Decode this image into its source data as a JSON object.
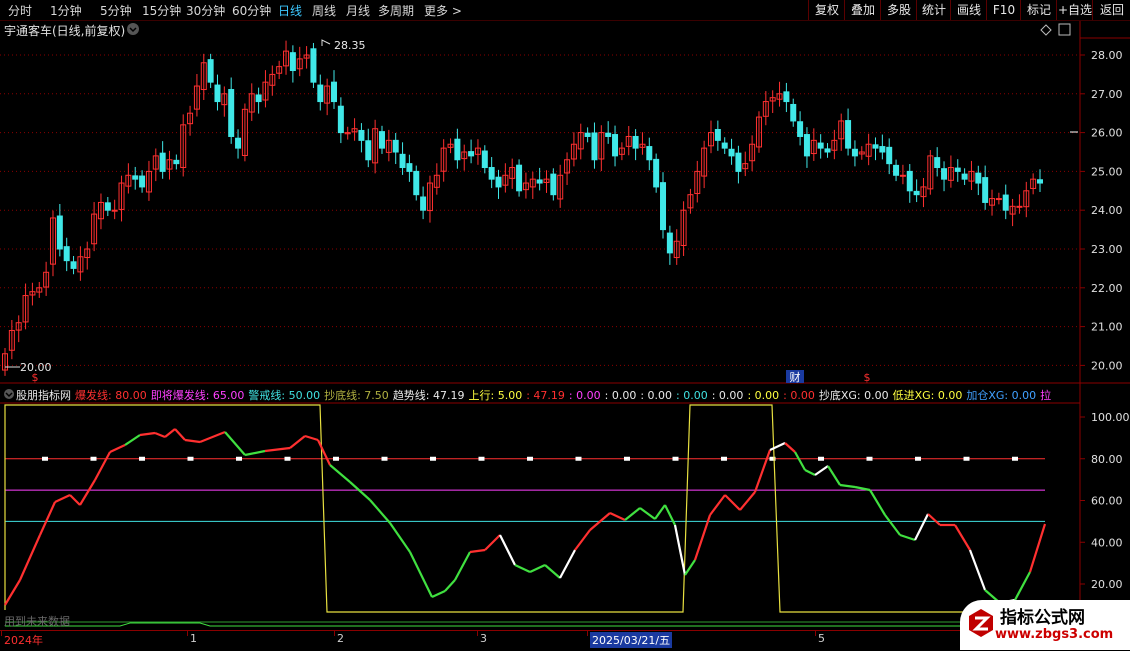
{
  "toolbar": {
    "periods": [
      "分时",
      "1分钟",
      "5分钟",
      "15分钟",
      "30分钟",
      "60分钟",
      "日线",
      "周线",
      "月线",
      "多周期",
      "更多 >"
    ],
    "active_period": "日线",
    "right_buttons": [
      "复权",
      "叠加",
      "多股",
      "统计",
      "画线",
      "F10",
      "标记",
      "+自选",
      "返回"
    ]
  },
  "main_chart": {
    "title": "宇通客车(日线,前复权)",
    "price_ticks": [
      "28.00",
      "27.00",
      "26.00",
      "25.00",
      "24.00",
      "23.00",
      "22.00",
      "21.00",
      "20.00"
    ],
    "high_label": "28.35",
    "low_label": "20.00",
    "event_markers": [
      "$",
      "财",
      "$"
    ]
  },
  "indicator": {
    "name": "股朋指标网",
    "items": [
      {
        "label": "爆发线: 80.00",
        "color": "#ff3030"
      },
      {
        "label": "即将爆发线: 65.00",
        "color": "#ff40ff"
      },
      {
        "label": "警戒线: 50.00",
        "color": "#40e0e0"
      },
      {
        "label": "抄底线: 7.50",
        "color": "#b0b040"
      },
      {
        "label": "趋势线: 47.19",
        "color": "#e8e8e8"
      },
      {
        "label": "上行: 5.00",
        "color": "#ffff40"
      },
      {
        "label": ": 47.19",
        "color": "#ff3030"
      },
      {
        "label": ": 0.00",
        "color": "#ff40ff"
      },
      {
        "label": ": 0.00",
        "color": "#e8e8e8"
      },
      {
        "label": ": 0.00",
        "color": "#e8e8e8"
      },
      {
        "label": ": 0.00",
        "color": "#40e0e0"
      },
      {
        "label": ": 0.00",
        "color": "#e8e8e8"
      },
      {
        "label": ": 0.00",
        "color": "#ffff40"
      },
      {
        "label": ": 0.00",
        "color": "#ff3030"
      },
      {
        "label": "抄底XG: 0.00",
        "color": "#e8e8e8"
      },
      {
        "label": "低进XG: 0.00",
        "color": "#ffff40"
      },
      {
        "label": "加仓XG: 0.00",
        "color": "#40a0ff"
      },
      {
        "label": "拉",
        "color": "#ff40ff"
      }
    ],
    "value_ticks": [
      "100.00",
      "80.00",
      "60.00",
      "40.00",
      "20.00"
    ],
    "bottom_note": "用到未来数据"
  },
  "date_axis": {
    "labels": [
      "2024年",
      "1",
      "2",
      "3",
      "2025/03/21/五",
      "5"
    ],
    "selected": "2025/03/21/五"
  },
  "watermark": {
    "title": "指标公式网",
    "url": "www.zbgs3.com"
  },
  "colors": {
    "up": "#ff3030",
    "down": "#40e8e8",
    "grid": "#8a0000",
    "axis_text": "#e0e0e0"
  }
}
